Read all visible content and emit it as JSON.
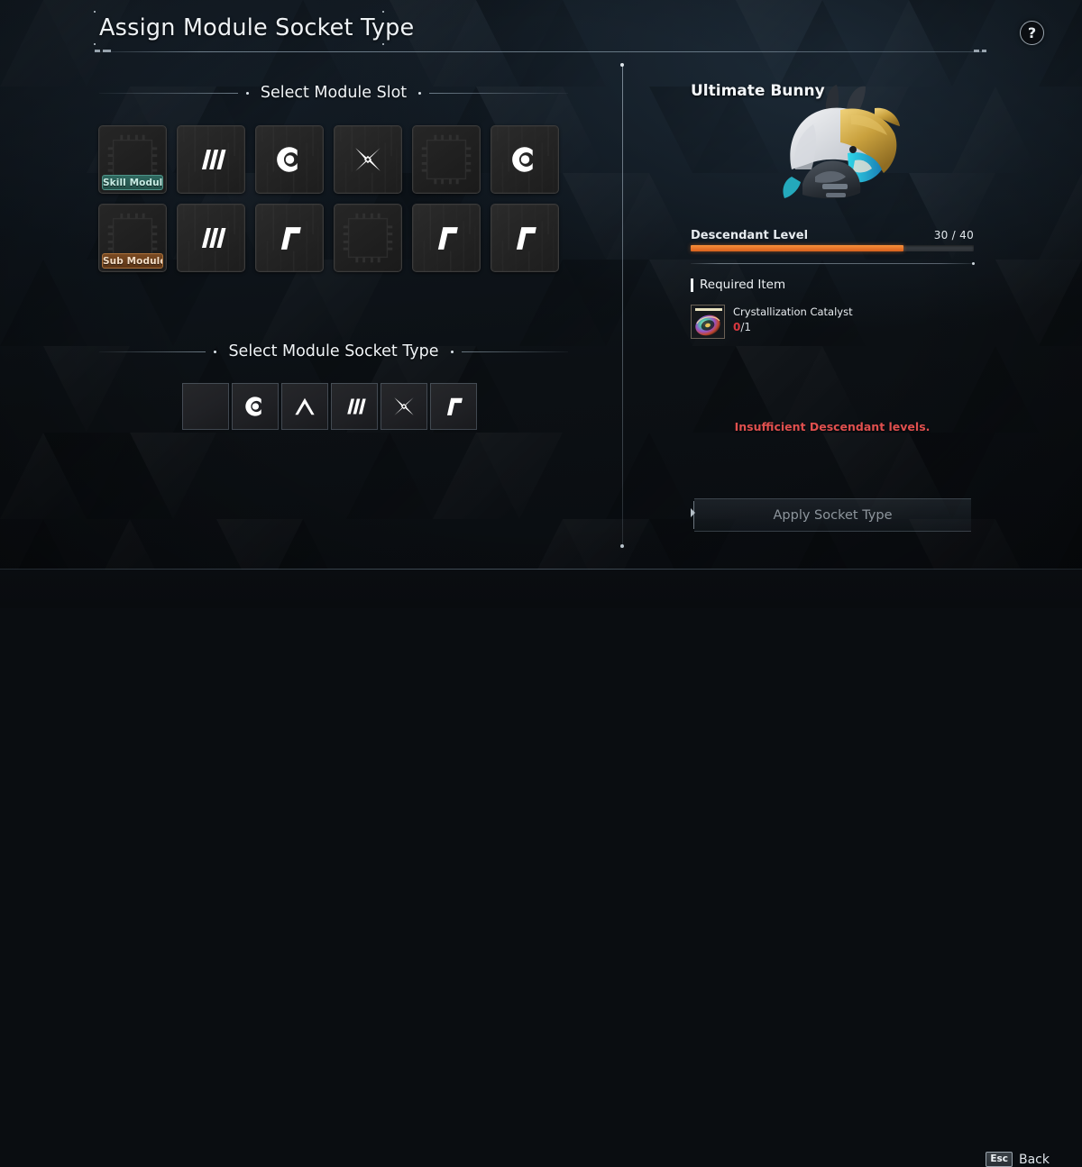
{
  "window": {
    "title": "Assign Module Socket Type",
    "help_icon": "question-mark-icon"
  },
  "sections": {
    "module_slot": {
      "heading": "Select Module Slot"
    },
    "socket_type": {
      "heading": "Select Module Socket Type"
    }
  },
  "module_slots": {
    "rows": [
      [
        {
          "symbol": "none",
          "tag": "Skill Modules",
          "tag_style": "skill",
          "empty": true
        },
        {
          "symbol": "malachite",
          "tag": "",
          "tag_style": "",
          "empty": false
        },
        {
          "symbol": "cerulean",
          "tag": "",
          "tag_style": "",
          "empty": false
        },
        {
          "symbol": "xantic",
          "tag": "",
          "tag_style": "",
          "empty": false
        },
        {
          "symbol": "none",
          "tag": "",
          "tag_style": "",
          "empty": true
        },
        {
          "symbol": "cerulean",
          "tag": "",
          "tag_style": "",
          "empty": false
        }
      ],
      [
        {
          "symbol": "none",
          "tag": "Sub Module",
          "tag_style": "sub",
          "empty": true
        },
        {
          "symbol": "malachite",
          "tag": "",
          "tag_style": "",
          "empty": false
        },
        {
          "symbol": "rutile",
          "tag": "",
          "tag_style": "",
          "empty": false
        },
        {
          "symbol": "none",
          "tag": "",
          "tag_style": "",
          "empty": true
        },
        {
          "symbol": "rutile",
          "tag": "",
          "tag_style": "",
          "empty": false
        },
        {
          "symbol": "rutile",
          "tag": "",
          "tag_style": "",
          "empty": false
        }
      ]
    ]
  },
  "socket_types": [
    {
      "symbol": "none",
      "name": "blank-socket"
    },
    {
      "symbol": "cerulean",
      "name": "cerulean-socket"
    },
    {
      "symbol": "almandine",
      "name": "almandine-socket"
    },
    {
      "symbol": "malachite",
      "name": "malachite-socket"
    },
    {
      "symbol": "xantic",
      "name": "xantic-socket"
    },
    {
      "symbol": "rutile",
      "name": "rutile-socket"
    }
  ],
  "character": {
    "name": "Ultimate Bunny"
  },
  "level": {
    "label": "Descendant Level",
    "value_text": "30 / 40",
    "current": 30,
    "max": 40,
    "percent": 75,
    "fill_color": "#e8742a"
  },
  "required_item": {
    "heading": "Required Item",
    "item_name": "Crystallization Catalyst",
    "owned": "0",
    "needed": "/1"
  },
  "status": {
    "error": "Insufficient Descendant levels.",
    "error_color": "#e0504f"
  },
  "apply": {
    "label": "Apply Socket Type",
    "enabled": false
  },
  "footer": {
    "key": "Esc",
    "action": "Back"
  }
}
